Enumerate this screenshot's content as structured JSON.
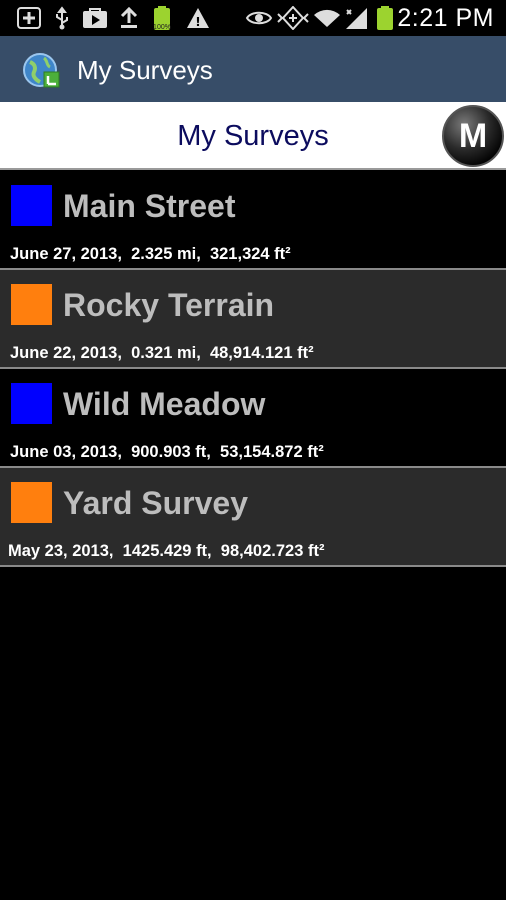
{
  "status_bar": {
    "battery_small_label": "100%",
    "time": "2:21 PM"
  },
  "action_bar": {
    "title": "My Surveys"
  },
  "header": {
    "title": "My Surveys",
    "m_button_label": "M"
  },
  "surveys": [
    {
      "name": "Main Street",
      "details": "June 27, 2013,  2.325 mi,  321,324 ft²",
      "color": "#0000ff"
    },
    {
      "name": "Rocky Terrain",
      "details": "June 22, 2013,  0.321 mi,  48,914.121 ft²",
      "color": "#ff7f0e"
    },
    {
      "name": "Wild Meadow",
      "details": "June 03, 2013,  900.903 ft,  53,154.872 ft²",
      "color": "#0000ff"
    },
    {
      "name": "Yard Survey",
      "details": "May 23, 2013,  1425.429 ft,  98,402.723 ft²",
      "color": "#ff7f0e"
    }
  ]
}
